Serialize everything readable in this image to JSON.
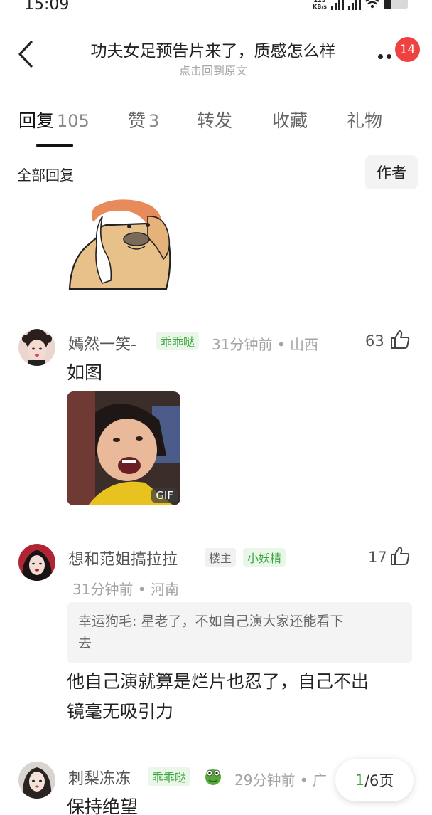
{
  "status_bar": {
    "time": "15:09",
    "net_speed_value": "225",
    "net_speed_unit": "KB/s"
  },
  "header": {
    "title": "功夫女足预告片来了，质感怎么样",
    "subtitle": "点击回到原文",
    "notification_count": "14"
  },
  "tabs": [
    {
      "label": "回复",
      "count": "105",
      "active": true
    },
    {
      "label": "赞",
      "count": "3"
    },
    {
      "label": "转发",
      "count": ""
    },
    {
      "label": "收藏",
      "count": ""
    },
    {
      "label": "礼物",
      "count": ""
    }
  ],
  "section": {
    "title": "全部回复",
    "author_filter": "作者"
  },
  "replies": [
    {
      "username": "嫣然一笑-",
      "badges": [
        "乖乖哒"
      ],
      "time": "31分钟前",
      "location": "山西",
      "likes": "63",
      "text": "如图",
      "gif_label": "GIF"
    },
    {
      "username": "想和范姐搞拉拉",
      "badges": [
        "楼主",
        "小妖精"
      ],
      "time": "31分钟前",
      "location": "河南",
      "likes": "17",
      "quote_author": "幸运狗毛:",
      "quote_line1": "星老了，不如自己演大家还能看下",
      "quote_line2": "去",
      "text_line1": "他自己演就算是烂片也忍了，自己不出",
      "text_line2": "镜毫无吸引力"
    },
    {
      "username": "刺梨冻冻",
      "badges": [
        "乖乖哒"
      ],
      "time": "29分钟前",
      "location": "广",
      "text": "保持绝望"
    }
  ],
  "pager": {
    "current": "1",
    "total": "/6页"
  },
  "colors": {
    "accent_green": "#3aa53f",
    "badge_red": "#f04141"
  }
}
